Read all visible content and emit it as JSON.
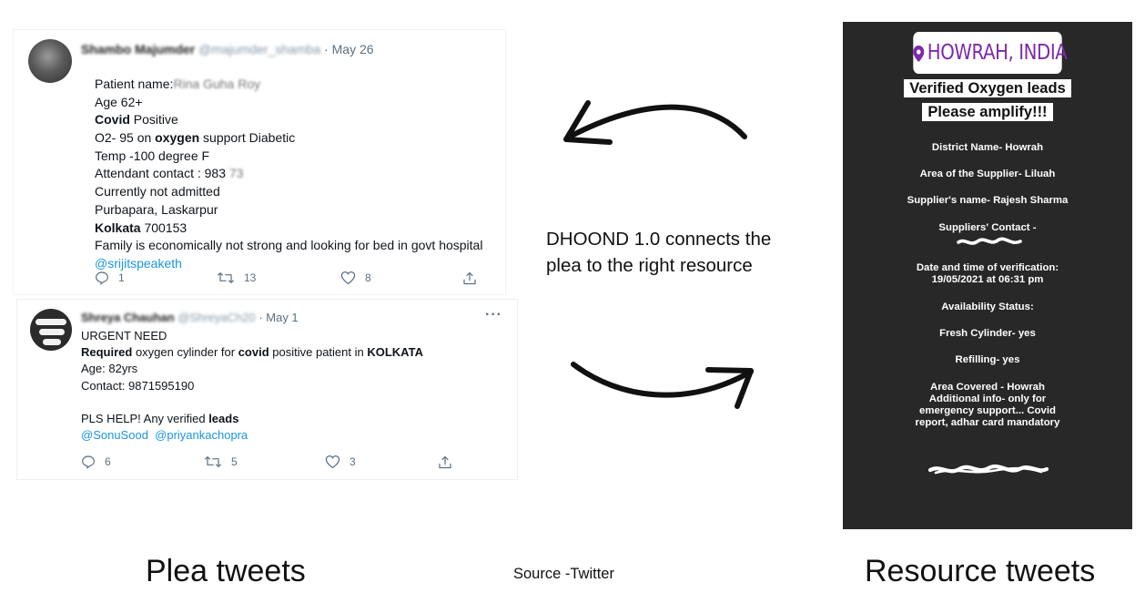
{
  "tweet1": {
    "author_name": "Shambo Majumder",
    "author_handle": "@majumder_shamba",
    "date": "· May 26",
    "lines": {
      "l1_label": "Patient name:",
      "l1_value": "Rina Guha Roy",
      "l2": "Age 62+",
      "l3_bold": "Covid",
      "l3_rest": " Positive",
      "l4_a": "O2- 95 on ",
      "l4_bold": "oxygen",
      "l4_b": " support Diabetic",
      "l5": "Temp -100 degree F",
      "l6": "Attendant contact : 983",
      "l6_hidden": "73",
      "l7": "Currently not admitted",
      "l8": "Purbapara, Laskarpur",
      "l9_bold": "Kolkata",
      "l9_rest": " 700153",
      "l10": "Family is economically not strong and looking for bed in govt hospital",
      "l11_link": "@srijitspeaketh"
    },
    "replies": "1",
    "retweets": "13",
    "likes": "8"
  },
  "tweet2": {
    "author_name": "Shreya Chauhan",
    "author_handle": "@ShreyaCh20",
    "date": "· May 1",
    "more": "···",
    "lines": {
      "l1": "URGENT NEED",
      "l2_bold1": "Required",
      "l2_a": " oxygen cylinder for ",
      "l2_bold2": "covid",
      "l2_b": " positive patient in ",
      "l2_bold3": "KOLKATA",
      "l3": "Age: 82yrs",
      "l4": "Contact: 9871595190",
      "l5_a": "PLS HELP! Any verified ",
      "l5_bold": "leads",
      "l6_link1": "@SonuSood",
      "l6_link2": "@priyankachopra"
    },
    "replies": "6",
    "retweets": "5",
    "likes": "3"
  },
  "center_text": {
    "line1": "DHOOND 1.0 connects the",
    "line2": "plea to the right resource"
  },
  "resource": {
    "location": "HOWRAH, INDIA",
    "headline1": "Verified Oxygen leads",
    "headline2": "Please amplify!!!",
    "district": "District Name- Howrah",
    "area_supplier": "Area of the Supplier- Liluah",
    "supplier_name": "Supplier's name- Rajesh Sharma",
    "supplier_contact": "Suppliers' Contact -",
    "verification_label": "Date and time of verification:",
    "verification_value": "19/05/2021 at 06:31 pm",
    "availability": "Availability Status:",
    "fresh": "Fresh Cylinder- yes",
    "refilling": "Refilling- yes",
    "covered1": "Area Covered -  Howrah",
    "covered2": "Additional info-  only for",
    "covered3": "emergency support... Covid",
    "covered4": "report, adhar card mandatory"
  },
  "captions": {
    "left": "Plea tweets",
    "source": "Source -Twitter",
    "right": "Resource tweets"
  },
  "colors": {
    "link": "#1b95e0",
    "story_bg": "#282828",
    "location_text": "#7d2aa8",
    "muted": "#5b7083"
  }
}
